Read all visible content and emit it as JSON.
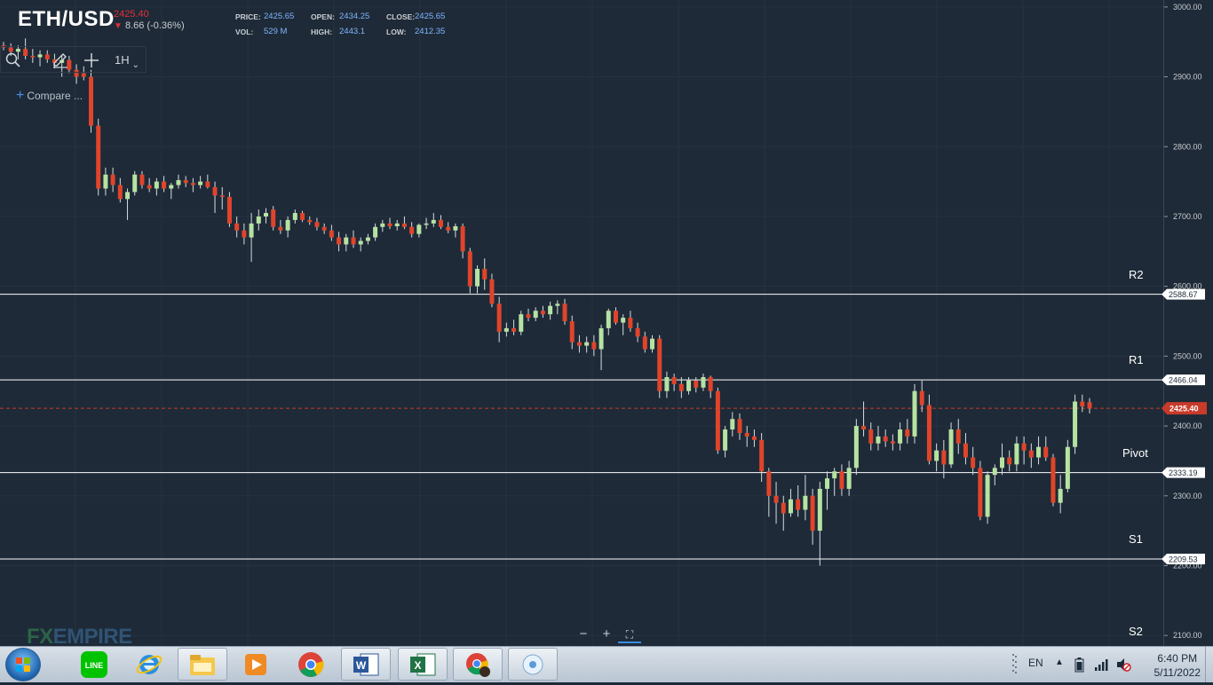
{
  "header": {
    "symbol": "ETH/USD",
    "last_price": "2425.40",
    "change": "8.66 (-0.36%)",
    "stats": {
      "price_label": "PRICE:",
      "price": "2425.65",
      "open_label": "OPEN:",
      "open": "2434.25",
      "close_label": "CLOSE:",
      "close": "2425.65",
      "vol_label": "VOL:",
      "vol": "529 M",
      "high_label": "HIGH:",
      "high": "2443.1",
      "low_label": "LOW:",
      "low": "2412.35"
    }
  },
  "toolbar": {
    "timeframe": "1H",
    "compare": "Compare ..."
  },
  "colors": {
    "up": "#b6e3a2",
    "down": "#e0442b",
    "background": "#1e2a37",
    "level_line": "#ffffff",
    "current_price": "#c83a2a"
  },
  "levels": [
    {
      "name": "R2",
      "value": 2588.67,
      "value_label": "2588.67"
    },
    {
      "name": "R1",
      "value": 2466.04,
      "value_label": "2466.04"
    },
    {
      "name": "Pivot",
      "value": 2333.19,
      "value_label": "2333.19"
    },
    {
      "name": "S1",
      "value": 2209.53,
      "value_label": "2209.53"
    },
    {
      "name": "S2",
      "value": 2077,
      "value_label": ""
    }
  ],
  "current_price": {
    "value": 2425.4,
    "label": "2425.40"
  },
  "chart_data": {
    "type": "candlestick",
    "ylim": [
      2085,
      3010
    ],
    "y_ticks": [
      "3000.00",
      "2900.00",
      "2800.00",
      "2700.00",
      "2600.00",
      "2500.00",
      "2400.00",
      "2300.00",
      "2200.00",
      "2100.00"
    ],
    "ohlc": [
      [
        2945,
        2950,
        2938,
        2942
      ],
      [
        2942,
        2948,
        2930,
        2936
      ],
      [
        2936,
        2945,
        2925,
        2940
      ],
      [
        2940,
        2955,
        2925,
        2930
      ],
      [
        2930,
        2940,
        2920,
        2928
      ],
      [
        2928,
        2938,
        2915,
        2932
      ],
      [
        2932,
        2938,
        2920,
        2925
      ],
      [
        2925,
        2933,
        2912,
        2920
      ],
      [
        2920,
        2930,
        2900,
        2924
      ],
      [
        2924,
        2930,
        2905,
        2910
      ],
      [
        2910,
        2918,
        2890,
        2900
      ],
      [
        2905,
        2915,
        2895,
        2900
      ],
      [
        2900,
        2910,
        2820,
        2830
      ],
      [
        2830,
        2840,
        2730,
        2740
      ],
      [
        2740,
        2770,
        2730,
        2760
      ],
      [
        2760,
        2770,
        2735,
        2745
      ],
      [
        2745,
        2755,
        2720,
        2725
      ],
      [
        2725,
        2740,
        2695,
        2735
      ],
      [
        2735,
        2765,
        2730,
        2760
      ],
      [
        2760,
        2765,
        2740,
        2745
      ],
      [
        2745,
        2755,
        2735,
        2740
      ],
      [
        2740,
        2755,
        2730,
        2750
      ],
      [
        2750,
        2758,
        2735,
        2740
      ],
      [
        2740,
        2748,
        2725,
        2745
      ],
      [
        2745,
        2760,
        2740,
        2752
      ],
      [
        2752,
        2758,
        2742,
        2748
      ],
      [
        2748,
        2755,
        2735,
        2745
      ],
      [
        2745,
        2758,
        2740,
        2750
      ],
      [
        2750,
        2760,
        2740,
        2742
      ],
      [
        2742,
        2750,
        2705,
        2730
      ],
      [
        2730,
        2742,
        2710,
        2728
      ],
      [
        2728,
        2735,
        2685,
        2690
      ],
      [
        2690,
        2700,
        2670,
        2680
      ],
      [
        2680,
        2690,
        2660,
        2670
      ],
      [
        2670,
        2705,
        2635,
        2690
      ],
      [
        2690,
        2710,
        2680,
        2700
      ],
      [
        2700,
        2712,
        2690,
        2705
      ],
      [
        2710,
        2715,
        2680,
        2685
      ],
      [
        2685,
        2695,
        2675,
        2680
      ],
      [
        2680,
        2700,
        2670,
        2695
      ],
      [
        2695,
        2710,
        2690,
        2705
      ],
      [
        2705,
        2708,
        2692,
        2695
      ],
      [
        2695,
        2700,
        2688,
        2692
      ],
      [
        2692,
        2698,
        2680,
        2685
      ],
      [
        2685,
        2690,
        2675,
        2680
      ],
      [
        2680,
        2688,
        2665,
        2670
      ],
      [
        2670,
        2678,
        2650,
        2660
      ],
      [
        2660,
        2675,
        2650,
        2670
      ],
      [
        2670,
        2680,
        2655,
        2660
      ],
      [
        2660,
        2670,
        2650,
        2665
      ],
      [
        2665,
        2675,
        2660,
        2670
      ],
      [
        2670,
        2690,
        2665,
        2685
      ],
      [
        2685,
        2695,
        2678,
        2690
      ],
      [
        2690,
        2698,
        2682,
        2686
      ],
      [
        2686,
        2695,
        2680,
        2690
      ],
      [
        2690,
        2700,
        2682,
        2685
      ],
      [
        2685,
        2692,
        2670,
        2675
      ],
      [
        2675,
        2690,
        2670,
        2688
      ],
      [
        2688,
        2698,
        2682,
        2690
      ],
      [
        2690,
        2705,
        2685,
        2695
      ],
      [
        2695,
        2702,
        2682,
        2685
      ],
      [
        2685,
        2692,
        2676,
        2680
      ],
      [
        2680,
        2690,
        2670,
        2686
      ],
      [
        2686,
        2690,
        2640,
        2650
      ],
      [
        2650,
        2655,
        2590,
        2600
      ],
      [
        2600,
        2630,
        2590,
        2625
      ],
      [
        2625,
        2640,
        2595,
        2610
      ],
      [
        2610,
        2618,
        2570,
        2575
      ],
      [
        2575,
        2585,
        2520,
        2535
      ],
      [
        2535,
        2548,
        2528,
        2540
      ],
      [
        2540,
        2552,
        2530,
        2535
      ],
      [
        2535,
        2565,
        2530,
        2560
      ],
      [
        2560,
        2568,
        2550,
        2555
      ],
      [
        2555,
        2570,
        2550,
        2565
      ],
      [
        2565,
        2572,
        2555,
        2560
      ],
      [
        2560,
        2578,
        2552,
        2572
      ],
      [
        2572,
        2580,
        2560,
        2575
      ],
      [
        2575,
        2582,
        2545,
        2550
      ],
      [
        2550,
        2558,
        2510,
        2520
      ],
      [
        2520,
        2530,
        2505,
        2515
      ],
      [
        2515,
        2528,
        2505,
        2520
      ],
      [
        2520,
        2530,
        2500,
        2510
      ],
      [
        2510,
        2545,
        2480,
        2540
      ],
      [
        2540,
        2568,
        2530,
        2565
      ],
      [
        2565,
        2570,
        2545,
        2548
      ],
      [
        2548,
        2560,
        2530,
        2555
      ],
      [
        2555,
        2565,
        2535,
        2540
      ],
      [
        2540,
        2548,
        2520,
        2528
      ],
      [
        2528,
        2535,
        2505,
        2510
      ],
      [
        2510,
        2530,
        2505,
        2525
      ],
      [
        2525,
        2530,
        2440,
        2450
      ],
      [
        2450,
        2478,
        2440,
        2470
      ],
      [
        2470,
        2475,
        2450,
        2460
      ],
      [
        2460,
        2470,
        2440,
        2450
      ],
      [
        2450,
        2470,
        2445,
        2465
      ],
      [
        2465,
        2470,
        2448,
        2455
      ],
      [
        2455,
        2475,
        2450,
        2470
      ],
      [
        2470,
        2472,
        2440,
        2450
      ],
      [
        2450,
        2455,
        2360,
        2365
      ],
      [
        2365,
        2400,
        2355,
        2395
      ],
      [
        2395,
        2420,
        2385,
        2410
      ],
      [
        2410,
        2418,
        2380,
        2390
      ],
      [
        2390,
        2400,
        2370,
        2385
      ],
      [
        2385,
        2395,
        2370,
        2380
      ],
      [
        2380,
        2390,
        2320,
        2335
      ],
      [
        2335,
        2340,
        2270,
        2300
      ],
      [
        2300,
        2320,
        2260,
        2290
      ],
      [
        2290,
        2300,
        2250,
        2275
      ],
      [
        2275,
        2310,
        2270,
        2295
      ],
      [
        2295,
        2315,
        2270,
        2280
      ],
      [
        2280,
        2330,
        2265,
        2300
      ],
      [
        2300,
        2310,
        2230,
        2250
      ],
      [
        2250,
        2320,
        2200,
        2310
      ],
      [
        2310,
        2335,
        2280,
        2325
      ],
      [
        2325,
        2340,
        2300,
        2335
      ],
      [
        2335,
        2345,
        2300,
        2310
      ],
      [
        2310,
        2350,
        2300,
        2340
      ],
      [
        2340,
        2410,
        2330,
        2400
      ],
      [
        2400,
        2435,
        2385,
        2395
      ],
      [
        2395,
        2405,
        2365,
        2375
      ],
      [
        2375,
        2400,
        2365,
        2385
      ],
      [
        2385,
        2395,
        2370,
        2378
      ],
      [
        2378,
        2388,
        2365,
        2375
      ],
      [
        2375,
        2405,
        2365,
        2395
      ],
      [
        2395,
        2410,
        2375,
        2385
      ],
      [
        2385,
        2460,
        2375,
        2450
      ],
      [
        2450,
        2465,
        2420,
        2430
      ],
      [
        2430,
        2445,
        2345,
        2350
      ],
      [
        2350,
        2375,
        2335,
        2365
      ],
      [
        2365,
        2380,
        2325,
        2345
      ],
      [
        2345,
        2405,
        2340,
        2395
      ],
      [
        2395,
        2410,
        2360,
        2375
      ],
      [
        2375,
        2390,
        2345,
        2355
      ],
      [
        2355,
        2370,
        2330,
        2340
      ],
      [
        2340,
        2350,
        2265,
        2270
      ],
      [
        2270,
        2335,
        2260,
        2330
      ],
      [
        2330,
        2345,
        2315,
        2340
      ],
      [
        2340,
        2375,
        2330,
        2355
      ],
      [
        2355,
        2365,
        2335,
        2345
      ],
      [
        2345,
        2385,
        2335,
        2375
      ],
      [
        2375,
        2385,
        2345,
        2365
      ],
      [
        2365,
        2375,
        2340,
        2355
      ],
      [
        2355,
        2385,
        2345,
        2370
      ],
      [
        2370,
        2385,
        2350,
        2355
      ],
      [
        2355,
        2360,
        2285,
        2290
      ],
      [
        2290,
        2330,
        2275,
        2310
      ],
      [
        2310,
        2380,
        2305,
        2370
      ],
      [
        2370,
        2445,
        2360,
        2435
      ],
      [
        2435,
        2445,
        2420,
        2428
      ],
      [
        2434,
        2440,
        2418,
        2425
      ]
    ]
  },
  "taskbar": {
    "language": "EN",
    "time": "6:40 PM",
    "date": "5/11/2022",
    "apps": [
      "line-icon",
      "ie-icon",
      "file-explorer-icon",
      "media-player-icon",
      "chrome-icon",
      "word-icon",
      "excel-icon",
      "chrome-profile-icon",
      "app-icon"
    ]
  },
  "watermark": {
    "fx": "FX",
    "empire": "EMPIRE"
  }
}
